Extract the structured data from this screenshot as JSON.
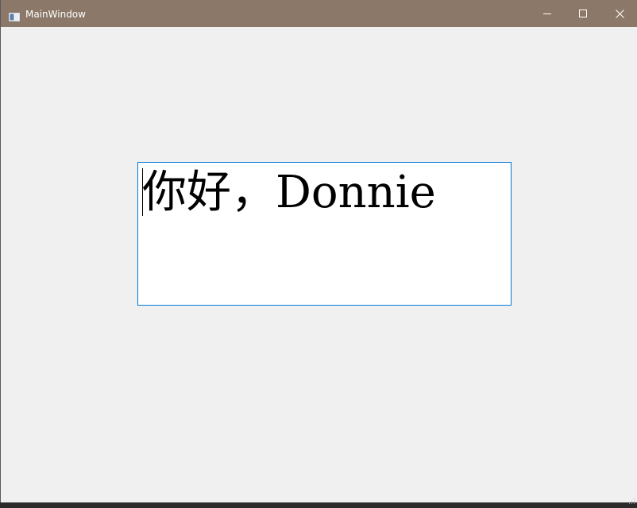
{
  "window": {
    "title": "MainWindow",
    "titlebar_color": "#8b7868",
    "icon": "app-window-icon"
  },
  "caption_buttons": {
    "minimize_icon": "minimize-icon",
    "maximize_icon": "maximize-icon",
    "close_icon": "close-icon"
  },
  "editor": {
    "text": "你好，Donnie",
    "border_color": "#0078d7",
    "background": "#ffffff"
  },
  "client": {
    "background": "#f0f0f0"
  }
}
